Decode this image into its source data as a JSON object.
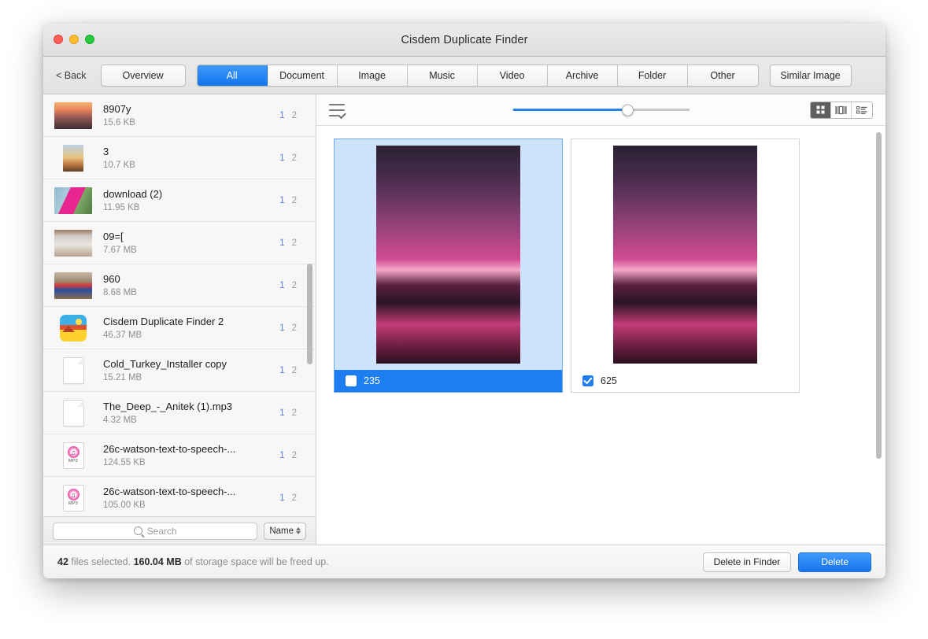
{
  "window": {
    "title": "Cisdem Duplicate Finder",
    "traffic_lights": [
      "close",
      "minimize",
      "zoom"
    ]
  },
  "toolbar": {
    "back_label": "< Back",
    "overview_label": "Overview",
    "tabs": [
      {
        "label": "All",
        "active": true
      },
      {
        "label": "Document",
        "active": false
      },
      {
        "label": "Image",
        "active": false
      },
      {
        "label": "Music",
        "active": false
      },
      {
        "label": "Video",
        "active": false
      },
      {
        "label": "Archive",
        "active": false
      },
      {
        "label": "Folder",
        "active": false
      },
      {
        "label": "Other",
        "active": false
      }
    ],
    "similar_image_label": "Similar Image"
  },
  "sidebar": {
    "files": [
      {
        "name": "8907y",
        "size": "15.6 KB",
        "count_selected": "1",
        "count_total": "2",
        "icon": "photo-thumbnail-sunset"
      },
      {
        "name": "3",
        "size": "10.7 KB",
        "count_selected": "1",
        "count_total": "2",
        "icon": "photo-thumbnail-portrait-sunset"
      },
      {
        "name": "download (2)",
        "size": "11.95 KB",
        "count_selected": "1",
        "count_total": "2",
        "icon": "photo-thumbnail-pink-jacket"
      },
      {
        "name": "09=[",
        "size": "7.67 MB",
        "count_selected": "1",
        "count_total": "2",
        "icon": "photo-thumbnail-sculpture"
      },
      {
        "name": "960",
        "size": "8.68 MB",
        "count_selected": "1",
        "count_total": "2",
        "icon": "photo-thumbnail-painted-pot"
      },
      {
        "name": "Cisdem Duplicate Finder 2",
        "size": "46.37 MB",
        "count_selected": "1",
        "count_total": "2",
        "icon": "app-icon"
      },
      {
        "name": "Cold_Turkey_Installer copy",
        "size": "15.21 MB",
        "count_selected": "1",
        "count_total": "2",
        "icon": "document-icon"
      },
      {
        "name": "The_Deep_-_Anitek (1).mp3",
        "size": "4.32 MB",
        "count_selected": "1",
        "count_total": "2",
        "icon": "document-icon"
      },
      {
        "name": "26c-watson-text-to-speech-...",
        "size": "124.55 KB",
        "count_selected": "1",
        "count_total": "2",
        "icon": "mp3-icon"
      },
      {
        "name": "26c-watson-text-to-speech-...",
        "size": "105.00 KB",
        "count_selected": "1",
        "count_total": "2",
        "icon": "mp3-icon"
      }
    ],
    "search": {
      "placeholder": "Search",
      "value": ""
    },
    "sort": {
      "label": "Name"
    }
  },
  "main": {
    "select_all_icon": "select-all-list-icon",
    "slider": {
      "value": 65,
      "min": 0,
      "max": 100
    },
    "view_modes": [
      {
        "name": "grid-view",
        "active": true
      },
      {
        "name": "coverflow-view",
        "active": false
      },
      {
        "name": "list-view",
        "active": false
      }
    ],
    "cards": [
      {
        "label": "235",
        "checked": false,
        "selected": true,
        "image": "pink-sunset-road"
      },
      {
        "label": "625",
        "checked": true,
        "selected": false,
        "image": "pink-sunset-road"
      }
    ]
  },
  "status": {
    "file_count": "42",
    "text_mid": " files selected. ",
    "freed_size": "160.04 MB",
    "text_end": " of storage space will be freed up.",
    "delete_in_finder_label": "Delete in Finder",
    "delete_label": "Delete"
  },
  "colors": {
    "accent_blue": "#1c7ef0",
    "tab_active": "#1373ef",
    "selection_bg": "#cfe2fb",
    "count_blue": "#5c7ce0"
  }
}
